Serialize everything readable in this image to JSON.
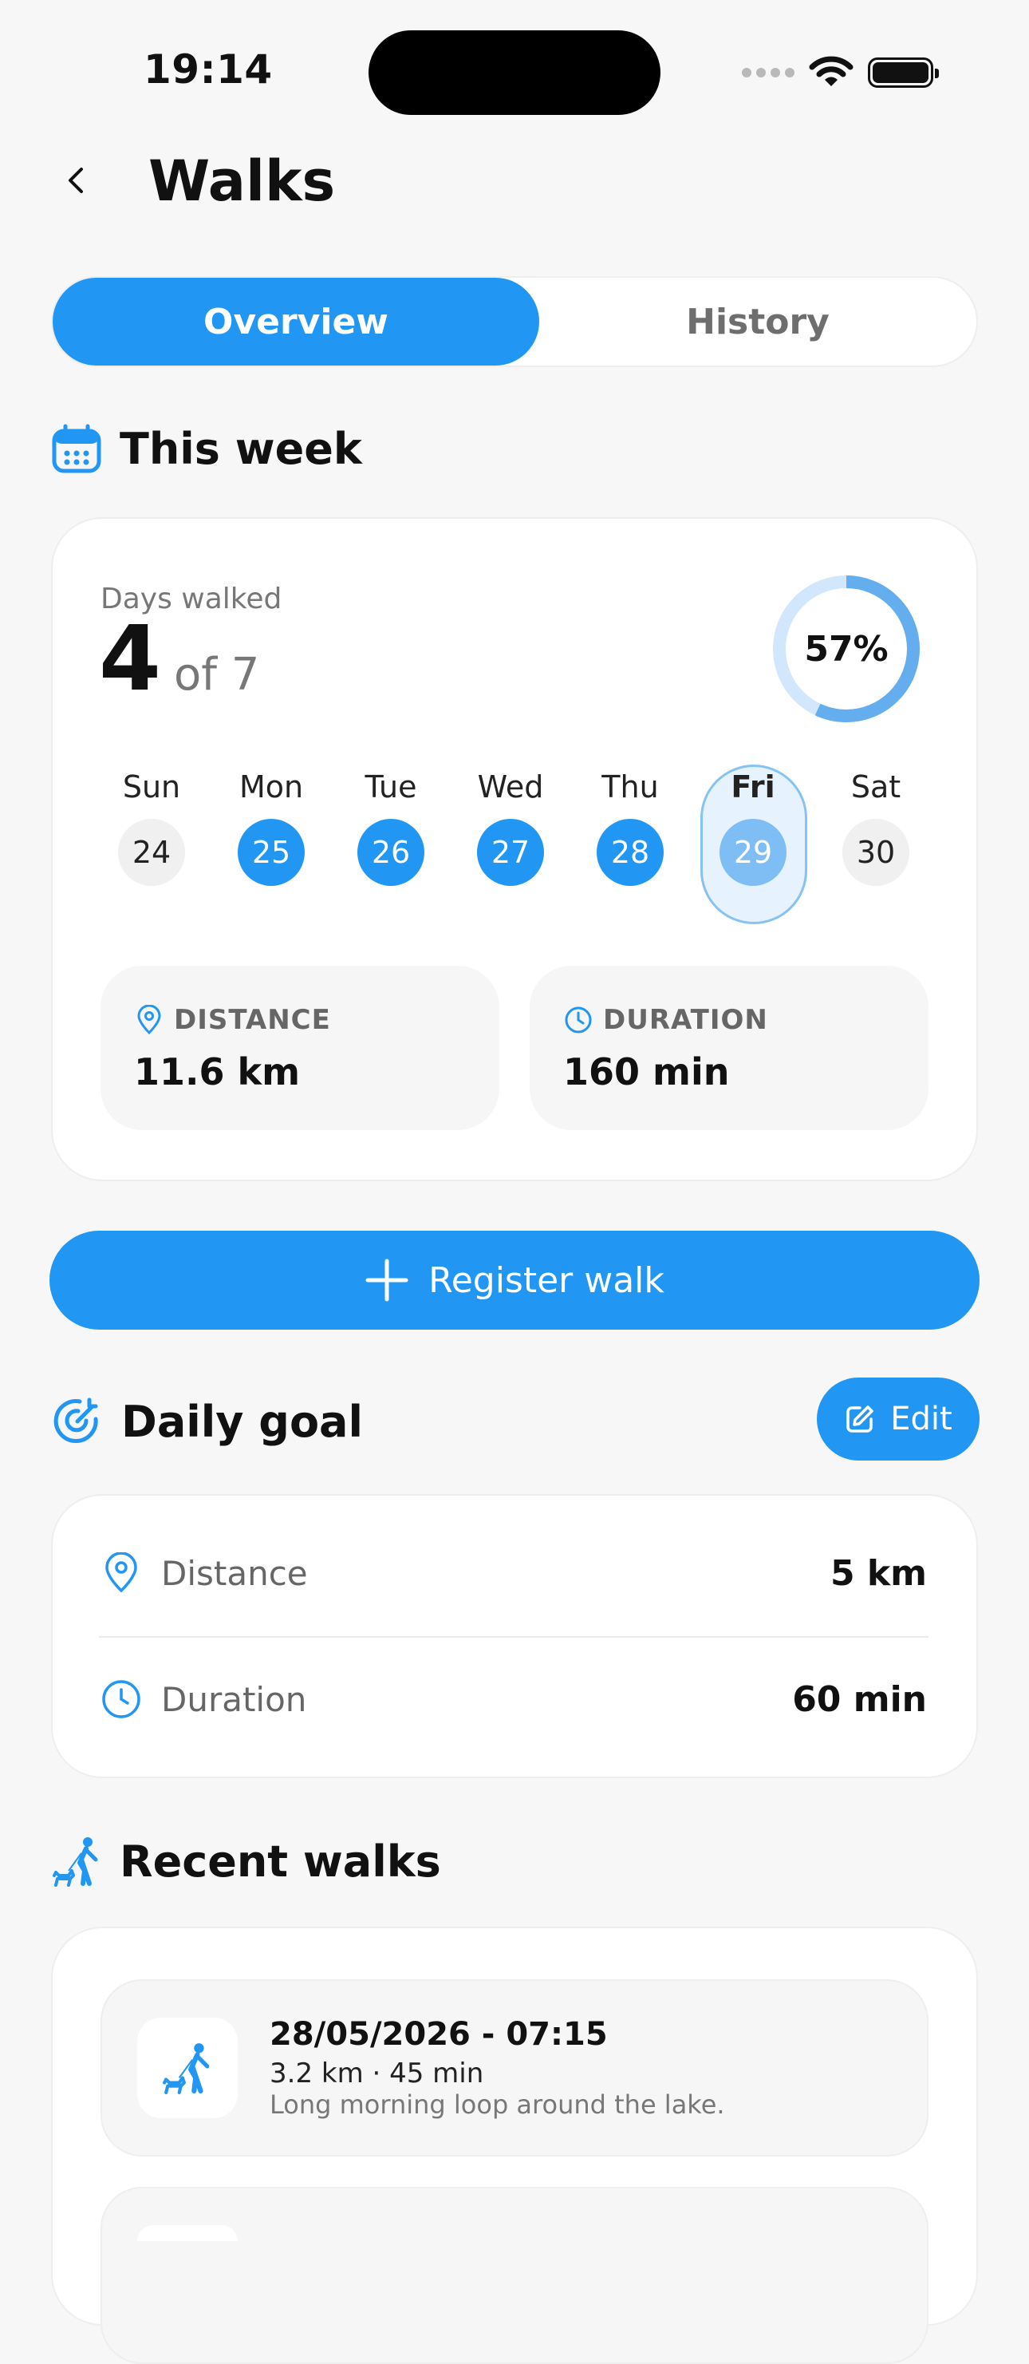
{
  "status_bar": {
    "time": "19:14"
  },
  "header": {
    "title": "Walks"
  },
  "tabs": [
    {
      "label": "Overview",
      "active": true
    },
    {
      "label": "History",
      "active": false
    }
  ],
  "week": {
    "heading": "This week",
    "days_label": "Days walked",
    "days_walked": "4",
    "days_total": "of 7",
    "percent_label": "57%",
    "percent": 0.57,
    "days": [
      {
        "name": "Sun",
        "date": "24",
        "state": "none"
      },
      {
        "name": "Mon",
        "date": "25",
        "state": "done"
      },
      {
        "name": "Tue",
        "date": "26",
        "state": "done"
      },
      {
        "name": "Wed",
        "date": "27",
        "state": "done"
      },
      {
        "name": "Thu",
        "date": "28",
        "state": "done"
      },
      {
        "name": "Fri",
        "date": "29",
        "state": "today"
      },
      {
        "name": "Sat",
        "date": "30",
        "state": "none"
      }
    ],
    "distance_label": "DISTANCE",
    "distance_value": "11.6 km",
    "duration_label": "DURATION",
    "duration_value": "160 min"
  },
  "register_button": "Register walk",
  "daily_goal": {
    "heading": "Daily goal",
    "edit_label": "Edit",
    "distance_label": "Distance",
    "distance_value": "5 km",
    "duration_label": "Duration",
    "duration_value": "60 min"
  },
  "recent": {
    "heading": "Recent walks",
    "items": [
      {
        "date": "28/05/2026 - 07:15",
        "meta": "3.2 km · 45 min",
        "note": "Long morning loop around the lake."
      }
    ]
  },
  "colors": {
    "accent": "#2196F3",
    "accent_light": "#7fbdf5",
    "background": "#f7f7f7"
  }
}
